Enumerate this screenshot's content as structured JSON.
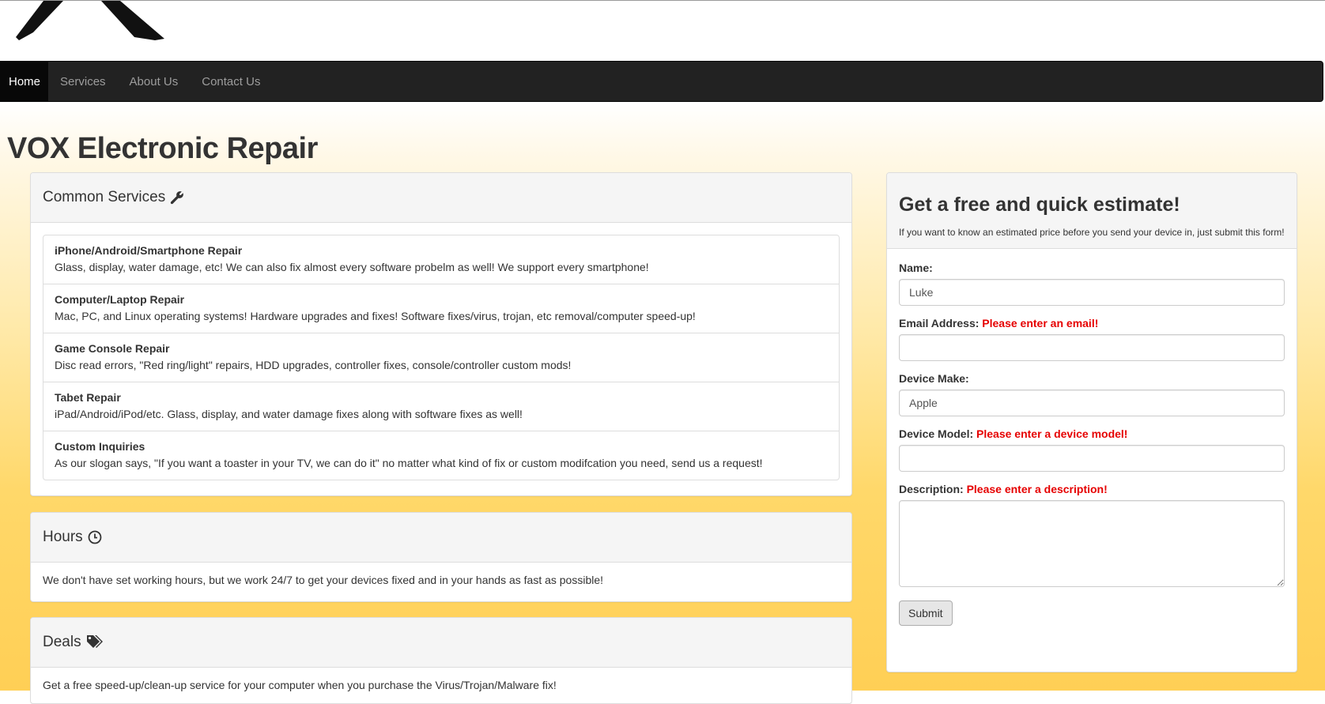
{
  "nav": {
    "items": [
      {
        "label": "Home",
        "active": true
      },
      {
        "label": "Services",
        "active": false
      },
      {
        "label": "About Us",
        "active": false
      },
      {
        "label": "Contact Us",
        "active": false
      }
    ]
  },
  "page": {
    "title": "VOX Electronic Repair"
  },
  "services": {
    "heading": "Common Services",
    "icon": "wrench-icon",
    "items": [
      {
        "title": "iPhone/Android/Smartphone Repair",
        "desc": "Glass, display, water damage, etc! We can also fix almost every software probelm as well! We support every smartphone!"
      },
      {
        "title": "Computer/Laptop Repair",
        "desc": "Mac, PC, and Linux operating systems! Hardware upgrades and fixes! Software fixes/virus, trojan, etc removal/computer speed-up!"
      },
      {
        "title": "Game Console Repair",
        "desc": "Disc read errors, \"Red ring/light\" repairs, HDD upgrades, controller fixes, console/controller custom mods!"
      },
      {
        "title": "Tabet Repair",
        "desc": "iPad/Android/iPod/etc. Glass, display, and water damage fixes along with software fixes as well!"
      },
      {
        "title": "Custom Inquiries",
        "desc": "As our slogan says, \"If you want a toaster in your TV, we can do it\" no matter what kind of fix or custom modifcation you need, send us a request!"
      }
    ]
  },
  "hours": {
    "heading": "Hours",
    "icon": "clock-icon",
    "text": "We don't have set working hours, but we work 24/7 to get your devices fixed and in your hands as fast as possible!"
  },
  "deals": {
    "heading": "Deals",
    "icon": "tags-icon",
    "text": "Get a free speed-up/clean-up service for your computer when you purchase the Virus/Trojan/Malware fix!"
  },
  "estimate": {
    "title": "Get a free and quick estimate!",
    "subtitle": "If you want to know an estimated price before you send your device in, just submit this form!",
    "fields": {
      "name": {
        "label": "Name:",
        "value": "Luke",
        "error": ""
      },
      "email": {
        "label": "Email Address:",
        "value": "",
        "error": "Please enter an email!"
      },
      "make": {
        "label": "Device Make:",
        "value": "Apple",
        "error": ""
      },
      "model": {
        "label": "Device Model:",
        "value": "",
        "error": "Please enter a device model!"
      },
      "description": {
        "label": "Description:",
        "value": "",
        "error": "Please enter a description!"
      }
    },
    "submit_label": "Submit"
  },
  "colors": {
    "navbar": "#222222",
    "error": "#e60000",
    "accent_gradient": "#ffcf55"
  }
}
